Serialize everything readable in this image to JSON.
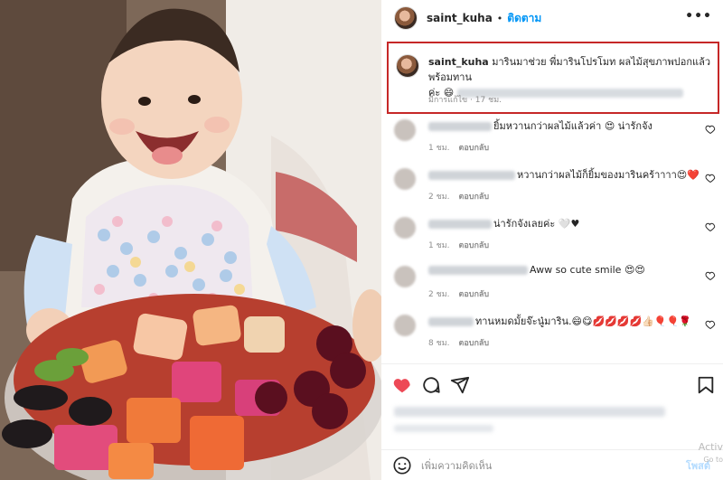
{
  "header": {
    "username": "saint_kuha",
    "separator": "•",
    "follow_label": "ติดตาม",
    "more_label": "•••"
  },
  "caption": {
    "username": "saint_kuha",
    "text": "มารินมาช่วย พี่มารินโปรโมท ผลไม้สุขภาพปอกแล้วพร้อมทาน",
    "text_line2": "ค่ะ 😄",
    "edited_label": "มีการแก้ไข",
    "time": "17 ชม."
  },
  "comments": [
    {
      "text": "ยิ้มหวานกว่าผลไม้แล้วค่า 😍 น่ารักจัง",
      "time": "1 ชม.",
      "reply_label": "ตอบกลับ"
    },
    {
      "text": "หวานกว่าผลไม้ก็ยิ้มของมารินคร้าาาา😍❤️",
      "time": "2 ชม.",
      "reply_label": "ตอบกลับ"
    },
    {
      "text": "น่ารักจังเลยค่ะ 🤍♥",
      "time": "1 ชม.",
      "reply_label": "ตอบกลับ"
    },
    {
      "text": "Aww so cute smile 😍😍",
      "time": "2 ชม.",
      "reply_label": "ตอบกลับ"
    },
    {
      "text": "ทานหมดมั้ยจ๊ะนู๋มาริน.😄😋💋💋💋💋👍🏻🎈🎈🌹",
      "time": "8 ชม.",
      "reply_label": "ตอบกลับ"
    }
  ],
  "add_comment": {
    "placeholder": "เพิ่มความคิดเห็น",
    "post_label": "โพสต์"
  },
  "watermark": {
    "line1": "Activ",
    "line2": "Go to"
  },
  "colors": {
    "follow_blue": "#0095f6",
    "like_red": "#ed4956",
    "highlight_border": "#c62828"
  },
  "icons": {
    "like": "heart-filled-icon",
    "comment": "comment-bubble-icon",
    "share": "paper-plane-icon",
    "save": "bookmark-icon",
    "emoji": "smiley-icon",
    "comment_like": "heart-outline-icon",
    "more": "more-dots-icon"
  }
}
